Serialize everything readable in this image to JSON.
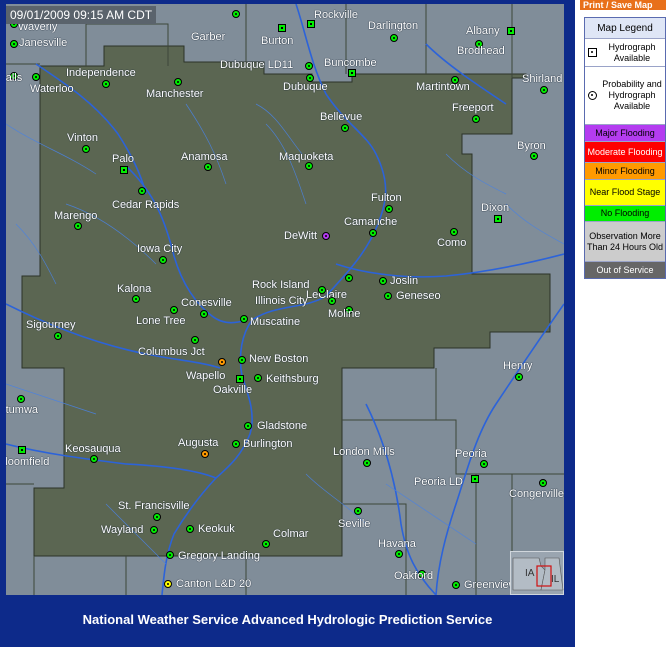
{
  "timestamp": "09/01/2009 09:15 AM CDT",
  "print_label": "Print / Save Map",
  "footer": "National Weather Service Advanced Hydrologic Prediction Service",
  "inset": {
    "left_label": "IA",
    "right_label": "IL"
  },
  "legend": {
    "title": "Map Legend",
    "hydrograph": "Hydrograph Available",
    "probability": "Probability and Hydrograph Available",
    "levels": [
      {
        "label": "Major Flooding",
        "color": "#b43cf0",
        "text": "#000000"
      },
      {
        "label": "Moderate Flooding",
        "color": "#ff0000",
        "text": "#ffffff"
      },
      {
        "label": "Minor Flooding",
        "color": "#ff9a00",
        "text": "#000000"
      },
      {
        "label": "Near Flood Stage",
        "color": "#ffff00",
        "text": "#000000"
      },
      {
        "label": "No Flooding",
        "color": "#00ee00",
        "text": "#000000"
      },
      {
        "label": "Observation More Than 24 Hours Old",
        "color": "#cccccc",
        "text": "#000000"
      },
      {
        "label": "Out of Service",
        "color": "#666666",
        "text": "#ffffff"
      }
    ]
  },
  "gauges": [
    {
      "name": "Waverly",
      "status": "No Flooding",
      "shape": "circle"
    },
    {
      "name": "Janesville",
      "status": "No Flooding",
      "shape": "circle"
    },
    {
      "name": "Falls",
      "status": "No Flooding",
      "shape": "circle"
    },
    {
      "name": "Waterloo",
      "status": "No Flooding",
      "shape": "circle"
    },
    {
      "name": "Independence",
      "status": "No Flooding",
      "shape": "circle"
    },
    {
      "name": "Garber",
      "status": "No Flooding",
      "shape": "circle"
    },
    {
      "name": "Rockville",
      "status": "No Flooding",
      "shape": "square"
    },
    {
      "name": "Burton",
      "status": "No Flooding",
      "shape": "square"
    },
    {
      "name": "Darlington",
      "status": "No Flooding",
      "shape": "circle"
    },
    {
      "name": "Albany",
      "status": "No Flooding",
      "shape": "square"
    },
    {
      "name": "Brodhead",
      "status": "No Flooding",
      "shape": "circle"
    },
    {
      "name": "Manchester",
      "status": "No Flooding",
      "shape": "circle"
    },
    {
      "name": "Dubuque LD11",
      "status": "No Flooding",
      "shape": "circle"
    },
    {
      "name": "Buncombe",
      "status": "No Flooding",
      "shape": "square"
    },
    {
      "name": "Dubuque",
      "status": "No Flooding",
      "shape": "circle"
    },
    {
      "name": "Martintown",
      "status": "No Flooding",
      "shape": "circle"
    },
    {
      "name": "Shirland",
      "status": "No Flooding",
      "shape": "circle"
    },
    {
      "name": "Freeport",
      "status": "No Flooding",
      "shape": "circle"
    },
    {
      "name": "Bellevue",
      "status": "No Flooding",
      "shape": "circle"
    },
    {
      "name": "Vinton",
      "status": "No Flooding",
      "shape": "circle"
    },
    {
      "name": "Byron",
      "status": "No Flooding",
      "shape": "circle"
    },
    {
      "name": "Palo",
      "status": "No Flooding",
      "shape": "square"
    },
    {
      "name": "Anamosa",
      "status": "No Flooding",
      "shape": "circle"
    },
    {
      "name": "Maquoketa",
      "status": "No Flooding",
      "shape": "circle"
    },
    {
      "name": "Cedar Rapids",
      "status": "No Flooding",
      "shape": "circle"
    },
    {
      "name": "Fulton",
      "status": "No Flooding",
      "shape": "circle"
    },
    {
      "name": "Dixon",
      "status": "No Flooding",
      "shape": "square"
    },
    {
      "name": "Marengo",
      "status": "No Flooding",
      "shape": "circle"
    },
    {
      "name": "Camanche",
      "status": "No Flooding",
      "shape": "circle"
    },
    {
      "name": "DeWitt",
      "status": "Major Flooding",
      "shape": "circle"
    },
    {
      "name": "Como",
      "status": "No Flooding",
      "shape": "circle"
    },
    {
      "name": "Iowa City",
      "status": "No Flooding",
      "shape": "circle"
    },
    {
      "name": "LeClaire",
      "status": "No Flooding",
      "shape": "circle"
    },
    {
      "name": "Joslin",
      "status": "No Flooding",
      "shape": "circle"
    },
    {
      "name": "Rock Island",
      "status": "No Flooding",
      "shape": "circle"
    },
    {
      "name": "Kalona",
      "status": "No Flooding",
      "shape": "circle"
    },
    {
      "name": "Geneseo",
      "status": "No Flooding",
      "shape": "circle"
    },
    {
      "name": "Illinois City",
      "status": "No Flooding",
      "shape": "circle"
    },
    {
      "name": "Conesville",
      "status": "No Flooding",
      "shape": "circle"
    },
    {
      "name": "Moline",
      "status": "No Flooding",
      "shape": "circle"
    },
    {
      "name": "Sigourney",
      "status": "No Flooding",
      "shape": "circle"
    },
    {
      "name": "Lone Tree",
      "status": "No Flooding",
      "shape": "circle"
    },
    {
      "name": "Muscatine",
      "status": "No Flooding",
      "shape": "circle"
    },
    {
      "name": "Columbus Jct",
      "status": "No Flooding",
      "shape": "circle"
    },
    {
      "name": "New Boston",
      "status": "No Flooding",
      "shape": "circle"
    },
    {
      "name": "Henry",
      "status": "No Flooding",
      "shape": "circle"
    },
    {
      "name": "Wapello",
      "status": "Minor Flooding",
      "shape": "circle"
    },
    {
      "name": "Keithsburg",
      "status": "No Flooding",
      "shape": "circle"
    },
    {
      "name": "Oakville",
      "status": "No Flooding",
      "shape": "square"
    },
    {
      "name": "Ottumwa",
      "status": "No Flooding",
      "shape": "circle"
    },
    {
      "name": "Gladstone",
      "status": "No Flooding",
      "shape": "circle"
    },
    {
      "name": "Augusta",
      "status": "Minor Flooding",
      "shape": "circle"
    },
    {
      "name": "Burlington",
      "status": "No Flooding",
      "shape": "circle"
    },
    {
      "name": "Bloomfield",
      "status": "No Flooding",
      "shape": "square"
    },
    {
      "name": "Keosauqua",
      "status": "No Flooding",
      "shape": "circle"
    },
    {
      "name": "London Mills",
      "status": "No Flooding",
      "shape": "circle"
    },
    {
      "name": "Peoria",
      "status": "No Flooding",
      "shape": "circle"
    },
    {
      "name": "Peoria LD",
      "status": "No Flooding",
      "shape": "square"
    },
    {
      "name": "Congerville",
      "status": "No Flooding",
      "shape": "circle"
    },
    {
      "name": "St. Francisville",
      "status": "No Flooding",
      "shape": "circle"
    },
    {
      "name": "Seville",
      "status": "No Flooding",
      "shape": "circle"
    },
    {
      "name": "Wayland",
      "status": "No Flooding",
      "shape": "circle"
    },
    {
      "name": "Keokuk",
      "status": "No Flooding",
      "shape": "circle"
    },
    {
      "name": "Colmar",
      "status": "No Flooding",
      "shape": "circle"
    },
    {
      "name": "Havana",
      "status": "No Flooding",
      "shape": "circle"
    },
    {
      "name": "Gregory Landing",
      "status": "No Flooding",
      "shape": "circle"
    },
    {
      "name": "Oakford",
      "status": "No Flooding",
      "shape": "circle"
    },
    {
      "name": "Canton L&D 20",
      "status": "Near Flood Stage",
      "shape": "circle"
    },
    {
      "name": "Greenview",
      "status": "No Flooding",
      "shape": "circle"
    }
  ]
}
